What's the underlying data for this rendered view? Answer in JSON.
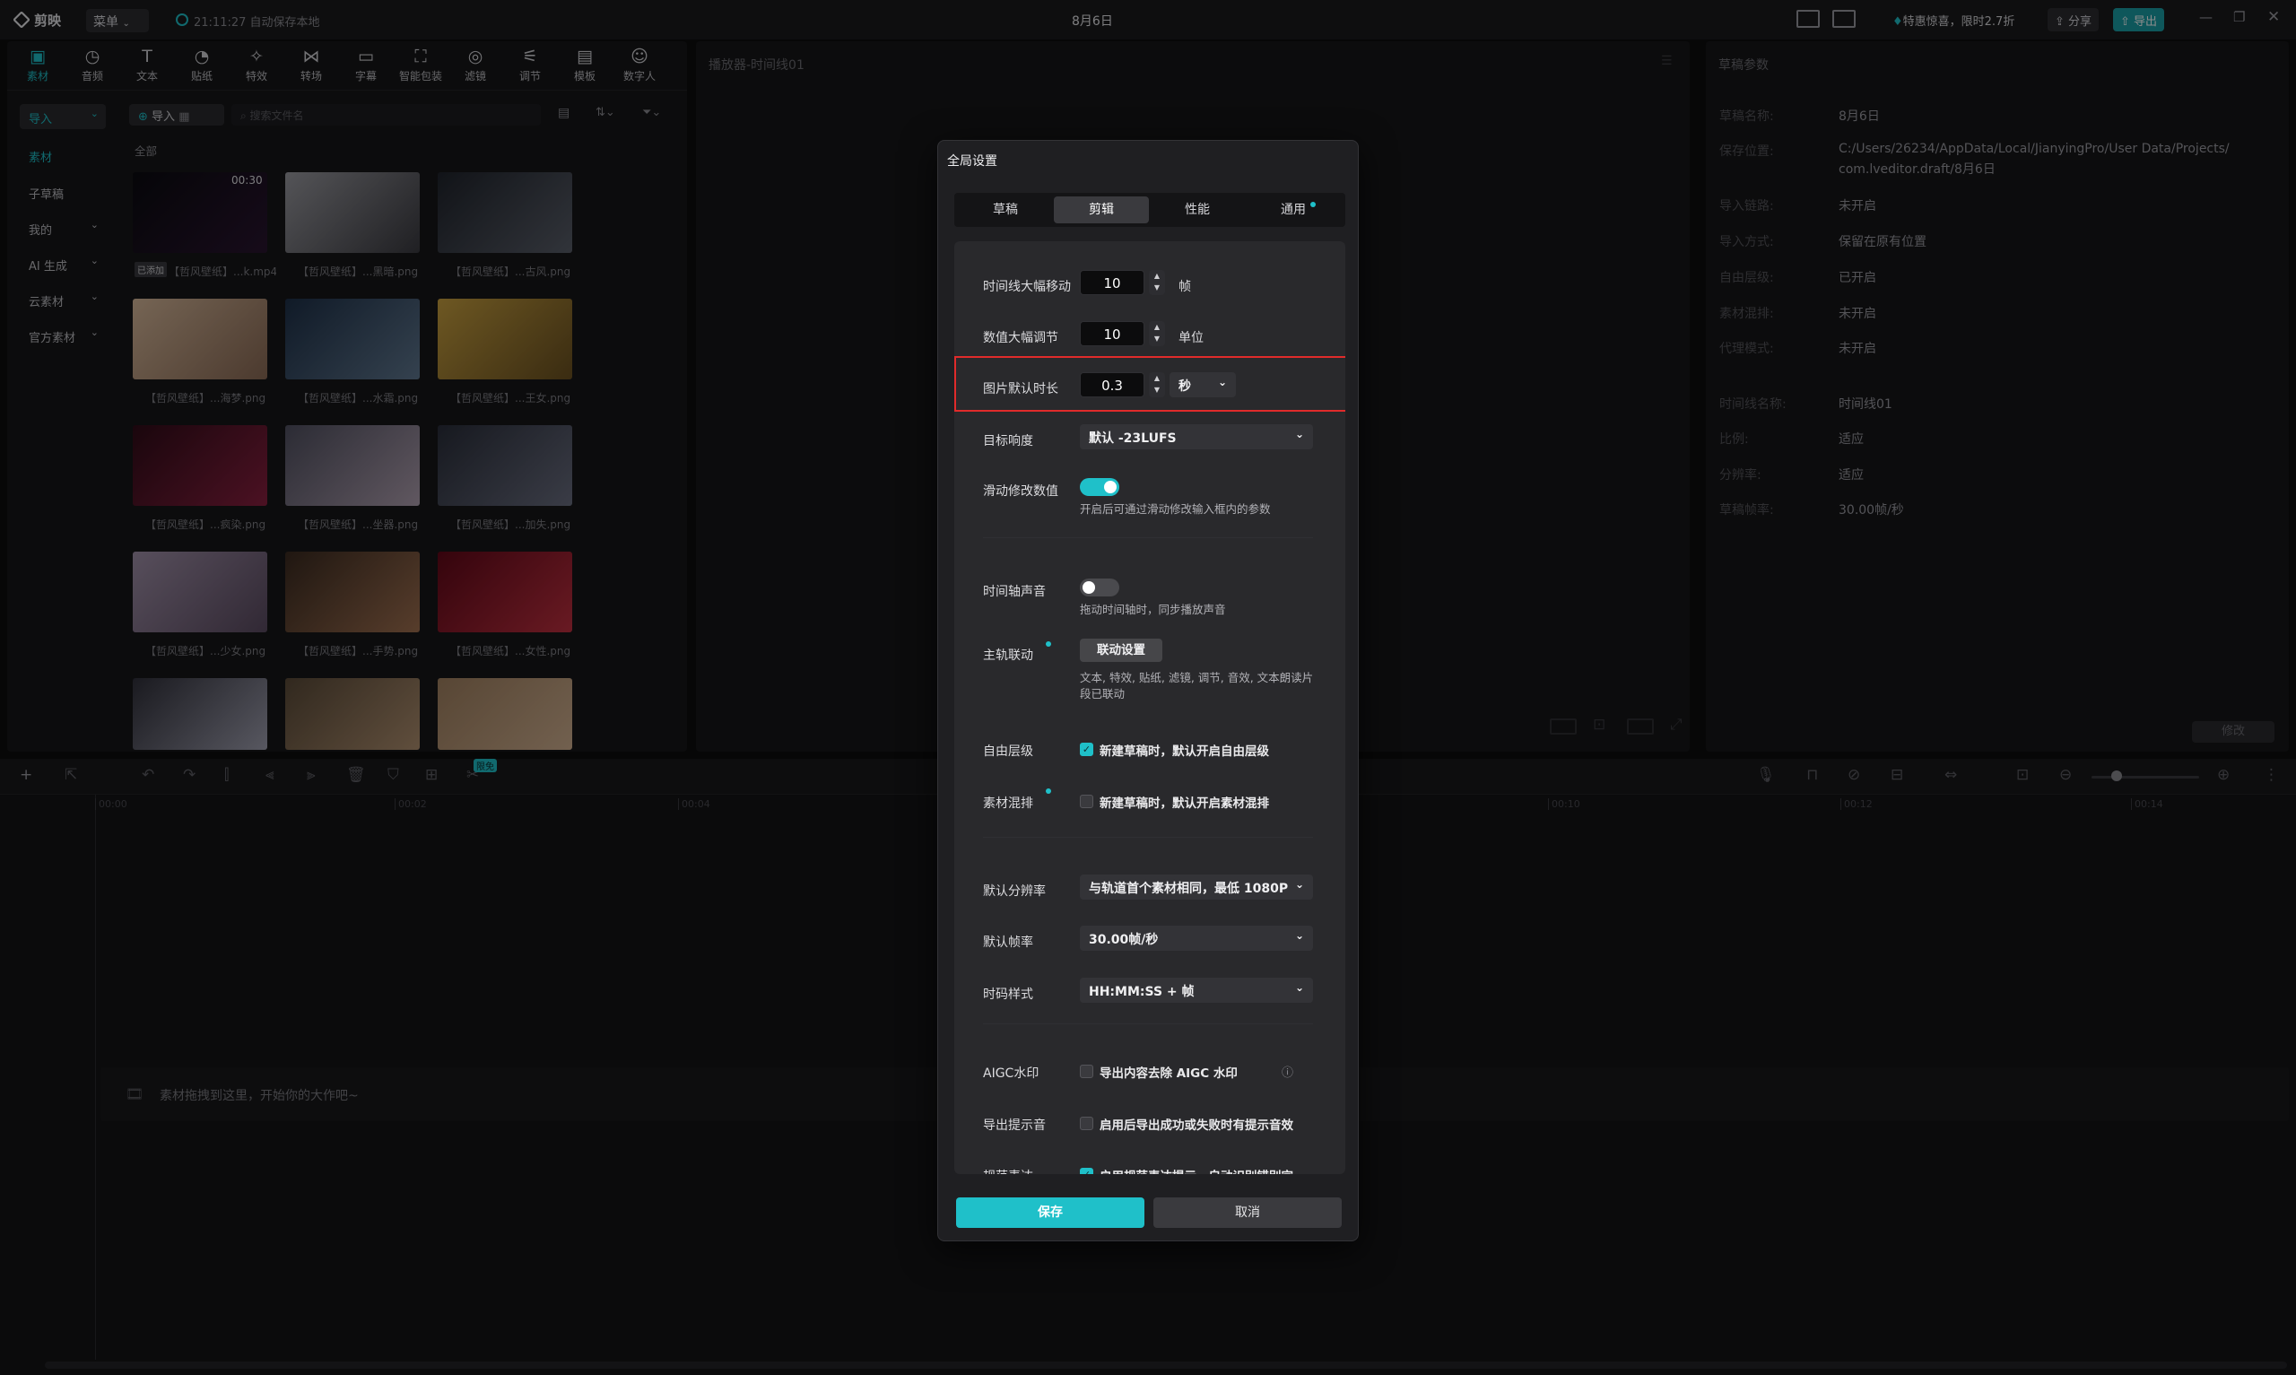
{
  "titlebar": {
    "app_name": "剪映",
    "menu_label": "菜单",
    "autosave": "21:11:27 自动保存本地",
    "project_title": "8月6日",
    "promo": "特惠惊喜，限时2.7折",
    "share_label": "分享",
    "export_label": "导出"
  },
  "toolbar": {
    "items": [
      {
        "label": "素材",
        "icon": "media-icon"
      },
      {
        "label": "音频",
        "icon": "audio-icon"
      },
      {
        "label": "文本",
        "icon": "text-icon"
      },
      {
        "label": "贴纸",
        "icon": "sticker-icon"
      },
      {
        "label": "特效",
        "icon": "effects-icon"
      },
      {
        "label": "转场",
        "icon": "transition-icon"
      },
      {
        "label": "字幕",
        "icon": "subtitle-icon"
      },
      {
        "label": "智能包装",
        "icon": "smart-pack-icon"
      },
      {
        "label": "滤镜",
        "icon": "filter-icon"
      },
      {
        "label": "调节",
        "icon": "adjust-icon"
      },
      {
        "label": "模板",
        "icon": "template-icon"
      },
      {
        "label": "数字人",
        "icon": "avatar-icon"
      }
    ]
  },
  "left_nav": [
    "导入",
    "素材",
    "子草稿",
    "我的",
    "AI 生成",
    "云素材",
    "官方素材"
  ],
  "media": {
    "import_label": "导入",
    "search_placeholder": "搜索文件名",
    "all_label": "全部",
    "first_duration": "00:30",
    "first_badge": "已添加",
    "items": [
      "【哲风壁纸】...k.mp4",
      "【哲风壁纸】...黑暗.png",
      "【哲风壁纸】...古风.png",
      "【哲风壁纸】...海梦.png",
      "【哲风壁纸】...水霜.png",
      "【哲风壁纸】...王女.png",
      "【哲风壁纸】...疯染.png",
      "【哲风壁纸】...坐器.png",
      "【哲风壁纸】...加失.png",
      "【哲风壁纸】...少女.png",
      "【哲风壁纸】...手势.png",
      "【哲风壁纸】...女性.png"
    ]
  },
  "player": {
    "title": "播放器-时间线01"
  },
  "draft_props": {
    "title": "草稿参数",
    "rows": [
      {
        "k": "草稿名称:",
        "v": "8月6日"
      },
      {
        "k": "保存位置:",
        "v": "C:/Users/26234/AppData/Local/JianyingPro/User Data/Projects/",
        "v2": "com.lveditor.draft/8月6日"
      },
      {
        "k": "导入链路:",
        "v": "未开启"
      },
      {
        "k": "导入方式:",
        "v": "保留在原有位置"
      },
      {
        "k": "自由层级:",
        "v": "已开启"
      },
      {
        "k": "素材混排:",
        "v": "未开启"
      },
      {
        "k": "代理模式:",
        "v": "未开启"
      },
      {
        "k": "时间线名称:",
        "v": "时间线01"
      },
      {
        "k": "比例:",
        "v": "适应"
      },
      {
        "k": "分辨率:",
        "v": "适应"
      },
      {
        "k": "草稿帧率:",
        "v": "30.00帧/秒"
      }
    ],
    "modify_label": "修改"
  },
  "timeline": {
    "ticks": [
      "00:00",
      "00:02",
      "00:04",
      "00:10",
      "00:12",
      "00:14"
    ],
    "empty_hint": "素材拖拽到这里，开始你的大作吧~",
    "badge": "限免"
  },
  "dialog": {
    "title": "全局设置",
    "tabs": [
      "草稿",
      "剪辑",
      "性能",
      "通用"
    ],
    "timeline_move": {
      "label": "时间线大幅移动",
      "value": "10",
      "unit": "帧"
    },
    "value_adjust": {
      "label": "数值大幅调节",
      "value": "10",
      "unit": "单位"
    },
    "image_duration": {
      "label": "图片默认时长",
      "value": "0.3",
      "unit": "秒"
    },
    "loudness": {
      "label": "目标响度",
      "value": "默认 -23LUFS"
    },
    "slide_modify": {
      "label": "滑动修改数值",
      "hint": "开启后可通过滑动修改输入框内的参数",
      "enabled": true
    },
    "timeline_sound": {
      "label": "时间轴声音",
      "hint": "拖动时间轴时，同步播放声音",
      "enabled": false
    },
    "main_track": {
      "label": "主轨联动",
      "button": "联动设置",
      "hint1": "文本, 特效, 贴纸, 滤镜, 调节, 音效, 文本朗读片",
      "hint2": "段已联动"
    },
    "free_layer": {
      "label": "自由层级",
      "text": "新建草稿时，默认开启自由层级",
      "checked": true
    },
    "material_mix": {
      "label": "素材混排",
      "text": "新建草稿时，默认开启素材混排",
      "checked": false
    },
    "resolution": {
      "label": "默认分辨率",
      "value": "与轨道首个素材相同，最低 1080P"
    },
    "framerate": {
      "label": "默认帧率",
      "value": "30.00帧/秒"
    },
    "timecode": {
      "label": "时码样式",
      "value": "HH:MM:SS + 帧"
    },
    "aigc": {
      "label": "AIGC水印",
      "text": "导出内容去除 AIGC 水印",
      "checked": false
    },
    "export_sound": {
      "label": "导出提示音",
      "text": "启用后导出成功或失败时有提示音效",
      "checked": false
    },
    "norm_expr": {
      "label": "规范表达",
      "text": "启用规范表达提示，自动识别错别字",
      "checked": true
    },
    "save_label": "保存",
    "cancel_label": "取消"
  },
  "colors": {
    "accent": "#1fc0c9",
    "highlight_box": "#e02b2b"
  }
}
